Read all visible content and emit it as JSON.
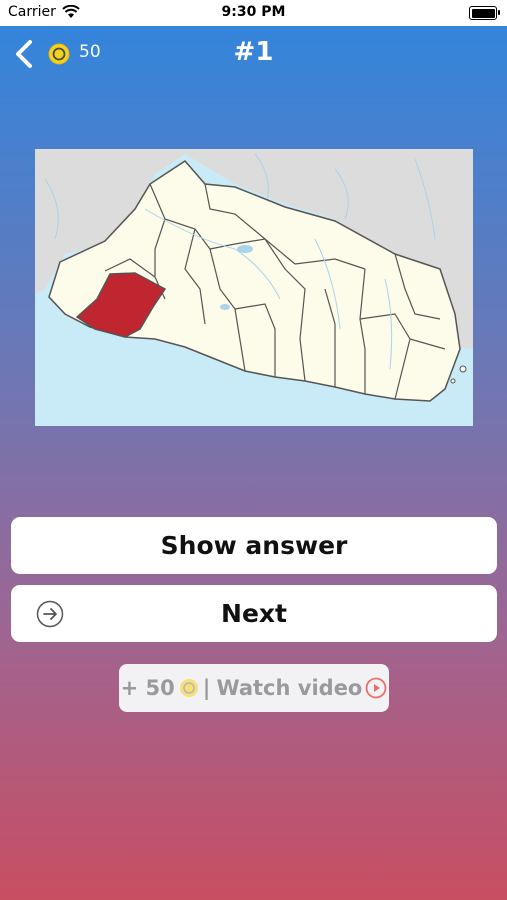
{
  "status_bar": {
    "carrier": "Carrier",
    "time": "9:30 PM"
  },
  "header": {
    "coins": "50",
    "title": "#1"
  },
  "quiz": {
    "highlighted_region_color": "#c0262f",
    "map_land_color": "#fdfbe9",
    "map_sea_color": "#c9eaf7",
    "map_neighbor_color": "#dcdcdc"
  },
  "buttons": {
    "show_answer": "Show answer",
    "next": "Next"
  },
  "reward": {
    "amount": "+ 50",
    "separator": "|",
    "label": "Watch video"
  },
  "icons": {
    "back": "chevron-left-icon",
    "coin": "coin-icon",
    "next": "arrow-right-circle-icon",
    "play": "play-circle-icon"
  }
}
